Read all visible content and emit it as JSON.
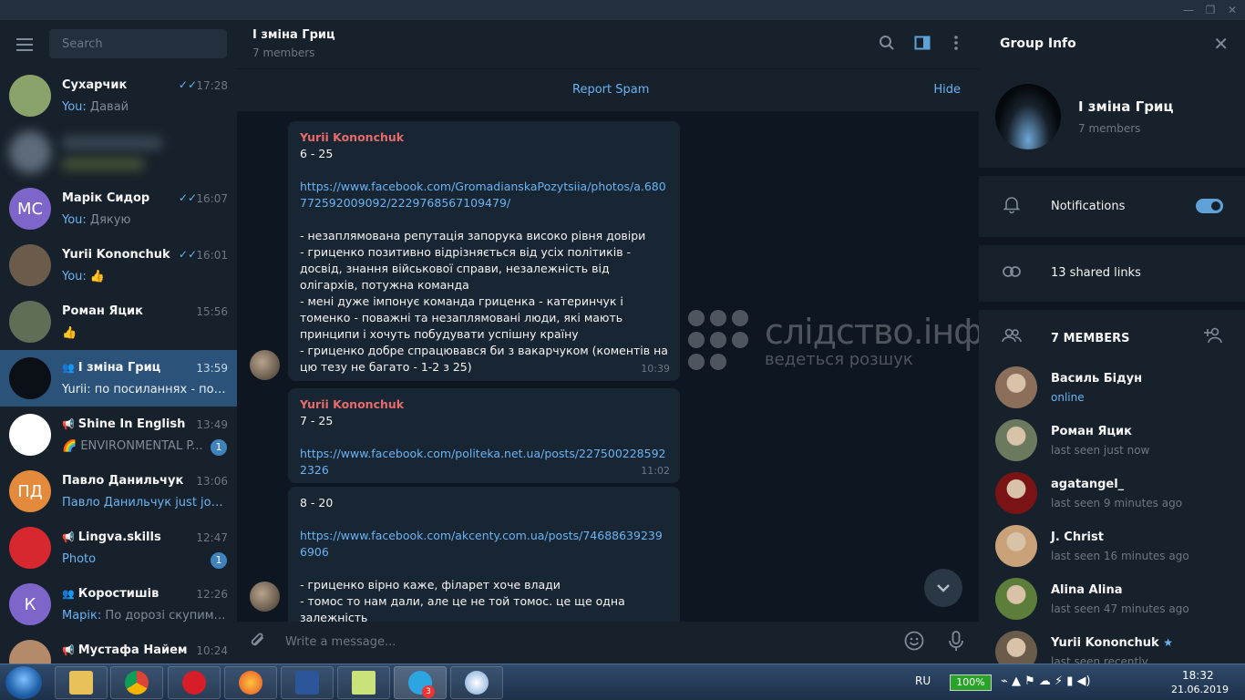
{
  "window": {
    "minimize": "—",
    "restore": "❐",
    "close": "✕"
  },
  "search": {
    "placeholder": "Search"
  },
  "chats": [
    {
      "name": "Сухарчик",
      "time": "17:28",
      "read": "✓✓",
      "prefix": "You: ",
      "preview": "Давай",
      "avatar_color": "#8aa36a"
    },
    {
      "name": "",
      "time": "",
      "read": "",
      "prefix": "",
      "preview": "",
      "avatar_color": "#5d6b7a"
    },
    {
      "name": "Марік Сидор",
      "time": "16:07",
      "read": "✓✓",
      "prefix": "You: ",
      "preview": "Дякую",
      "avatar_initials": "МС",
      "avatar_color": "#7e65c9"
    },
    {
      "name": "Yurii Kononchuk",
      "time": "16:01",
      "read": "✓✓",
      "prefix": "You: ",
      "preview": "👍",
      "avatar_color": "#6b5b4b"
    },
    {
      "name": "Роман Яцик",
      "time": "15:56",
      "read": "",
      "prefix": "",
      "preview": "👍",
      "avatar_color": "#5f6f57"
    },
    {
      "name": "I зміна Гриц",
      "time": "13:59",
      "read": "",
      "prefix": "",
      "preview": "Yurii: по посиланнях - по 23...",
      "active": true,
      "avatar_color": "#0b0f16"
    },
    {
      "name": "Shine In English",
      "time": "13:49",
      "read": "",
      "prefix": "",
      "preview": "🌈 ENVIRONMENTAL P...",
      "badge": "1",
      "avatar_color": "#ffffff"
    },
    {
      "name": "Павло Данильчук",
      "time": "13:06",
      "read": "",
      "prefix": "",
      "preview": "Павло Данильчук just joine...",
      "avatar_initials": "ПД",
      "avatar_color": "#e38a3d",
      "preview_link": true
    },
    {
      "name": "Lingva.skills",
      "time": "12:47",
      "read": "",
      "prefix": "",
      "preview": "Photo",
      "badge": "1",
      "avatar_color": "#d7282f",
      "preview_link": true
    },
    {
      "name": "Коростишів",
      "time": "12:26",
      "read": "",
      "prefix": "Марік: ",
      "preview": "По дорозі скупимось)",
      "avatar_initials": "К",
      "avatar_color": "#7e65c9"
    },
    {
      "name": "Мустафа Найем",
      "time": "10:24",
      "read": "",
      "prefix": "",
      "preview": "",
      "avatar_color": "#b58a6a"
    }
  ],
  "header": {
    "title": "I зміна Гриц",
    "subtitle": "7 members"
  },
  "spam": {
    "report": "Report Spam",
    "hide": "Hide"
  },
  "messages": [
    {
      "author": "Yurii Kononchuk",
      "lines_top": "6 - 25",
      "link": "https://www.facebook.com/GromadianskaPozytsiia/photos/a.680772592009092/2229768567109479/",
      "body": "- незаплямована репутація запорука високо рівня довіри\n- гриценко позитивно відрізняється від усіх політиків - досвід, знання військової справи, незалежність від олігархів, потужна команда\n- мені дуже імпонує команда гриценка - катеринчук і томенко - поважні та незаплямовані люди, які мають принципи і хочуть побудувати успішну країну\n- гриценко добре спрацювався би з вакарчуком (коментів на цю тезу не багато - 1-2 з 25)",
      "time": "10:39"
    },
    {
      "author": "Yurii Kononchuk",
      "lines_top": "7 - 25",
      "link": "https://www.facebook.com/politeka.net.ua/posts/2275002285922326",
      "body": "",
      "time": "11:02"
    },
    {
      "author": "",
      "lines_top": "8 - 20",
      "link": "https://www.facebook.com/akcenty.com.ua/posts/746886392396906",
      "body": "- гриценко вірно каже, філарет хоче влади\n- томос то нам дали, але це не той томос. це ще одна залежність\n- гриценко вірно каже, державне важливіше особистісного",
      "time": ""
    }
  ],
  "watermark": {
    "big": "слідство.інфо",
    "small": "ведеться розшук"
  },
  "composer": {
    "placeholder": "Write a message..."
  },
  "group_info": {
    "title": "Group Info",
    "name": "I зміна Гриц",
    "members_count": "7 members",
    "notifications_label": "Notifications",
    "notifications_on": true,
    "shared_links": "13 shared links",
    "members_title": "7 MEMBERS",
    "members": [
      {
        "name": "Василь Бідун",
        "status": "online",
        "online": true,
        "color": "#8b6f5a"
      },
      {
        "name": "Роман Яцик",
        "status": "last seen just now",
        "color": "#6b7a5f"
      },
      {
        "name": "agatangel_",
        "status": "last seen 9 minutes ago",
        "color": "#7a1414"
      },
      {
        "name": "J. Christ",
        "status": "last seen 16 minutes ago",
        "color": "#c9a27a"
      },
      {
        "name": "Alina Alina",
        "status": "last seen 47 minutes ago",
        "color": "#5d7d3b"
      },
      {
        "name": "Yurii Kononchuk",
        "status": "last seen recently",
        "star": "★",
        "color": "#6b5b4b"
      }
    ]
  },
  "taskbar": {
    "lang": "RU",
    "battery": "100%",
    "time": "18:32",
    "date": "21.06.2019",
    "telegram_badge": "3"
  }
}
